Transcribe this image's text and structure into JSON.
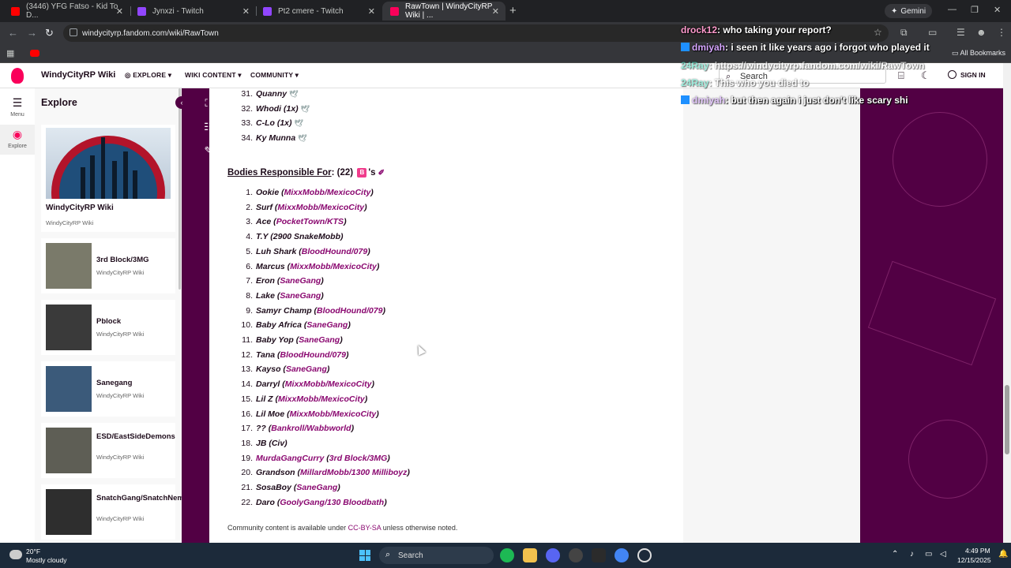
{
  "browser": {
    "tabs": [
      {
        "title": "(3446) YFG Fatso - Kid To D...",
        "fav_color": "#ff0000"
      },
      {
        "title": "Jynxzi - Twitch",
        "fav_color": "#9146ff"
      },
      {
        "title": "Pt2 cmere - Twitch",
        "fav_color": "#9146ff"
      },
      {
        "title": "RawTown | WindyCityRP Wiki | ...",
        "fav_color": "#fa005a"
      }
    ],
    "gemini_label": "Gemini",
    "url": "windycityrp.fandom.com/wiki/RawTown",
    "all_bookmarks": "All Bookmarks"
  },
  "fandom": {
    "wiki_name": "WindyCityRP Wiki",
    "nav": [
      "EXPLORE",
      "WIKI CONTENT",
      "COMMUNITY"
    ],
    "search_placeholder": "Search",
    "signin": "SIGN IN"
  },
  "rail": {
    "menu": "Menu",
    "explore": "Explore"
  },
  "explore": {
    "title": "Explore",
    "featured": {
      "name": "WindyCityRP Wiki",
      "sub": "WindyCityRP Wiki"
    },
    "cards": [
      {
        "name": "3rd Block/3MG",
        "sub": "WindyCityRP Wiki"
      },
      {
        "name": "Pblock",
        "sub": "WindyCityRP Wiki"
      },
      {
        "name": "Sanegang",
        "sub": "WindyCityRP Wiki"
      },
      {
        "name": "ESD/EastSideDemons",
        "sub": "WindyCityRP Wiki"
      },
      {
        "name": "SnatchGang/SnatchNem",
        "sub": "WindyCityRP Wiki"
      }
    ]
  },
  "article": {
    "top_list": [
      {
        "num": "31.",
        "name": "Quanny"
      },
      {
        "num": "32.",
        "name": "Whodi (1x)"
      },
      {
        "num": "33.",
        "name": "C-Lo (1x)"
      },
      {
        "num": "34.",
        "name": "Ky Munna"
      }
    ],
    "section_title": "Bodies Responsible For",
    "section_count": ": (22)",
    "section_suffix": "'s",
    "badge_letter": "B",
    "bodies": [
      {
        "num": "1.",
        "name": "Ookie",
        "group": "MixxMobb/MexicoCity"
      },
      {
        "num": "2.",
        "name": "Surf",
        "group": "MixxMobb/MexicoCity"
      },
      {
        "num": "3.",
        "name": "Ace",
        "group": "PocketTown/KTS"
      },
      {
        "num": "4.",
        "name": "T.Y (2900 SnakeMobb)",
        "group": ""
      },
      {
        "num": "5.",
        "name": "Luh Shark",
        "group": "BloodHound/079"
      },
      {
        "num": "6.",
        "name": "Marcus",
        "group": "MixxMobb/MexicoCity"
      },
      {
        "num": "7.",
        "name": "Eron",
        "group": "SaneGang"
      },
      {
        "num": "8.",
        "name": "Lake",
        "group": "SaneGang"
      },
      {
        "num": "9.",
        "name": "Samyr Champ",
        "group": "BloodHound/079"
      },
      {
        "num": "10.",
        "name": "Baby Africa",
        "group": "SaneGang"
      },
      {
        "num": "11.",
        "name": "Baby Yop",
        "group": "SaneGang"
      },
      {
        "num": "12.",
        "name": "Tana",
        "group": "BloodHound/079"
      },
      {
        "num": "13.",
        "name": "Kayso",
        "group": "SaneGang"
      },
      {
        "num": "14.",
        "name": "Darryl",
        "group": "MixxMobb/MexicoCity"
      },
      {
        "num": "15.",
        "name": "Lil Z",
        "group": "MixxMobb/MexicoCity"
      },
      {
        "num": "16.",
        "name": "Lil Moe",
        "group": "MixxMobb/MexicoCity"
      },
      {
        "num": "17.",
        "name": "??",
        "group": "Bankroll/Wabbworld"
      },
      {
        "num": "18.",
        "name": "JB (Civ)",
        "group": ""
      },
      {
        "num": "19.",
        "name": "MurdaGangCurry",
        "group": "3rd Block/3MG"
      },
      {
        "num": "20.",
        "name": "Grandson",
        "group": "MillardMobb/1300 Milliboyz"
      },
      {
        "num": "21.",
        "name": "SosaBoy",
        "group": "SaneGang"
      },
      {
        "num": "22.",
        "name": "Daro",
        "group": "GoolyGang/130 Bloodbath"
      }
    ],
    "footer_prefix": "Community content is available under ",
    "footer_link": "CC-BY-SA",
    "footer_suffix": " unless otherwise noted."
  },
  "chat": [
    {
      "user": "drock12",
      "msg": ": who taking your report?",
      "color": "#ff9acd"
    },
    {
      "user": "dmiyah",
      "msg": ": i seen it like years ago i forgot who played it",
      "color": "#d6a6ff"
    },
    {
      "user": "24Ray",
      "msg": ": https://windycityrp.fandom.com/wiki/RawTown",
      "color": "#4ee0c1"
    },
    {
      "user": "24Ray",
      "msg": ": This who you died to",
      "color": "#4ee0c1"
    },
    {
      "user": "dmiyah",
      "msg": ": but then again i just don't like scary shi",
      "color": "#d6a6ff"
    }
  ],
  "taskbar": {
    "temp": "20°F",
    "weather": "Mostly cloudy",
    "search": "Search",
    "time": "4:49 PM",
    "date": "12/15/2025"
  }
}
